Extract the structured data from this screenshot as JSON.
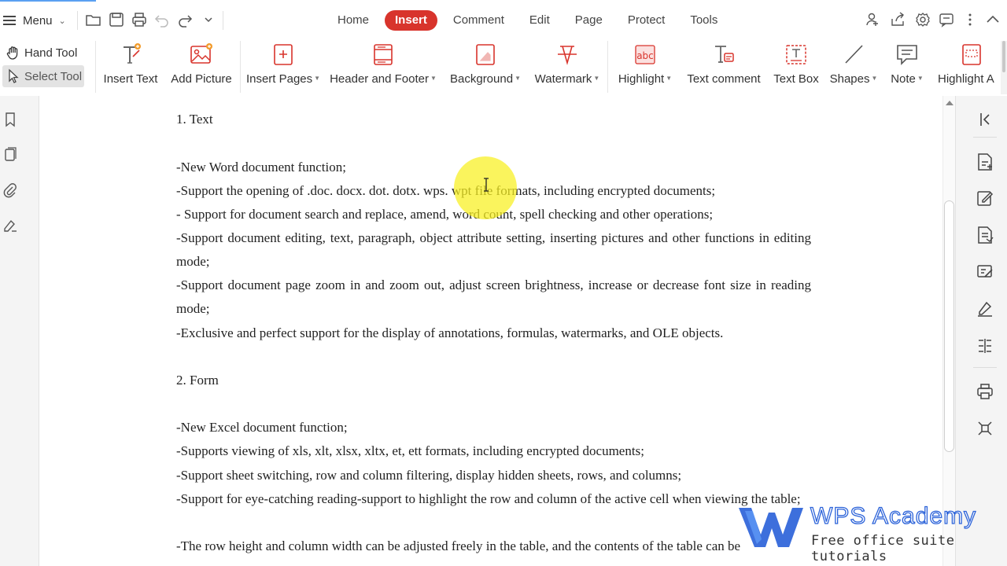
{
  "topbar": {
    "menu_label": "Menu",
    "tabs": [
      {
        "label": "Home",
        "active": false
      },
      {
        "label": "Insert",
        "active": true
      },
      {
        "label": "Comment",
        "active": false
      },
      {
        "label": "Edit",
        "active": false
      },
      {
        "label": "Page",
        "active": false
      },
      {
        "label": "Protect",
        "active": false
      },
      {
        "label": "Tools",
        "active": false
      }
    ],
    "quick_access_icons": [
      "open-folder-icon",
      "save-icon",
      "print-icon",
      "undo-icon",
      "redo-icon",
      "customize-dropdown-icon"
    ],
    "right_icons": [
      "share-user-icon",
      "export-icon",
      "settings-gear-icon",
      "chat-icon",
      "more-icon",
      "collapse-ribbon-icon"
    ]
  },
  "ribbon": {
    "hand_tool": "Hand Tool",
    "select_tool": "Select Tool",
    "items": [
      {
        "label": "Insert Text",
        "has_dropdown": false,
        "icon": "insert-text-icon"
      },
      {
        "label": "Add Picture",
        "has_dropdown": false,
        "icon": "add-picture-icon"
      },
      {
        "label": "Insert Pages",
        "has_dropdown": true,
        "icon": "insert-pages-icon"
      },
      {
        "label": "Header and Footer",
        "has_dropdown": true,
        "icon": "header-footer-icon"
      },
      {
        "label": "Background",
        "has_dropdown": true,
        "icon": "background-icon"
      },
      {
        "label": "Watermark",
        "has_dropdown": true,
        "icon": "watermark-icon"
      },
      {
        "label": "Highlight",
        "has_dropdown": true,
        "icon": "highlight-icon"
      },
      {
        "label": "Text comment",
        "has_dropdown": false,
        "icon": "text-comment-icon"
      },
      {
        "label": "Text Box",
        "has_dropdown": false,
        "icon": "text-box-icon"
      },
      {
        "label": "Shapes",
        "has_dropdown": true,
        "icon": "shapes-icon"
      },
      {
        "label": "Note",
        "has_dropdown": true,
        "icon": "note-icon"
      },
      {
        "label": "Highlight A",
        "has_dropdown": false,
        "icon": "highlight-area-icon"
      }
    ]
  },
  "left_sidebar_icons": [
    "bookmark-icon",
    "thumbnails-icon",
    "attachment-icon",
    "signature-icon"
  ],
  "right_sidebar_icons": [
    "collapse-panel-icon",
    "pdf-to-word-icon",
    "edit-pdf-icon",
    "pdf-convert-icon",
    "annotate-icon",
    "sign-icon",
    "compare-icon",
    "print-icon",
    "compress-icon"
  ],
  "document": {
    "section1_heading": "1.  Text",
    "section1_lines": [
      "-New Word document function;",
      "-Support the opening of .doc. docx. dot. dotx. wps. wpt file formats, including encrypted documents;",
      "- Support for document search and replace, amend, word count, spell checking and other operations;",
      "-Support document editing, text, paragraph, object attribute setting, inserting pictures and other functions in editing mode;",
      "-Support document page zoom in and zoom out, adjust screen brightness, increase or decrease font size in reading mode;",
      "-Exclusive and perfect support for the display of annotations, formulas, watermarks, and OLE objects."
    ],
    "section2_heading": "2.  Form",
    "section2_lines": [
      "-New Excel document function;",
      "-Supports viewing of xls, xlt, xlsx, xltx, et, ett formats, including encrypted documents;",
      "-Support sheet switching, row and column filtering, display hidden sheets, rows, and columns;",
      "-Support for eye-catching reading-support to highlight the row and column of the active cell when viewing the table;",
      "-The row height and column width can be adjusted freely in the table, and the contents of the table can be"
    ]
  },
  "watermark_overlay": {
    "title": "WPS Academy",
    "subtitle": "Free office suite tutorials"
  },
  "colors": {
    "active_tab": "#d8342c",
    "cursor_highlight": "#f8f01e",
    "brand_blue": "#2c63d9"
  }
}
